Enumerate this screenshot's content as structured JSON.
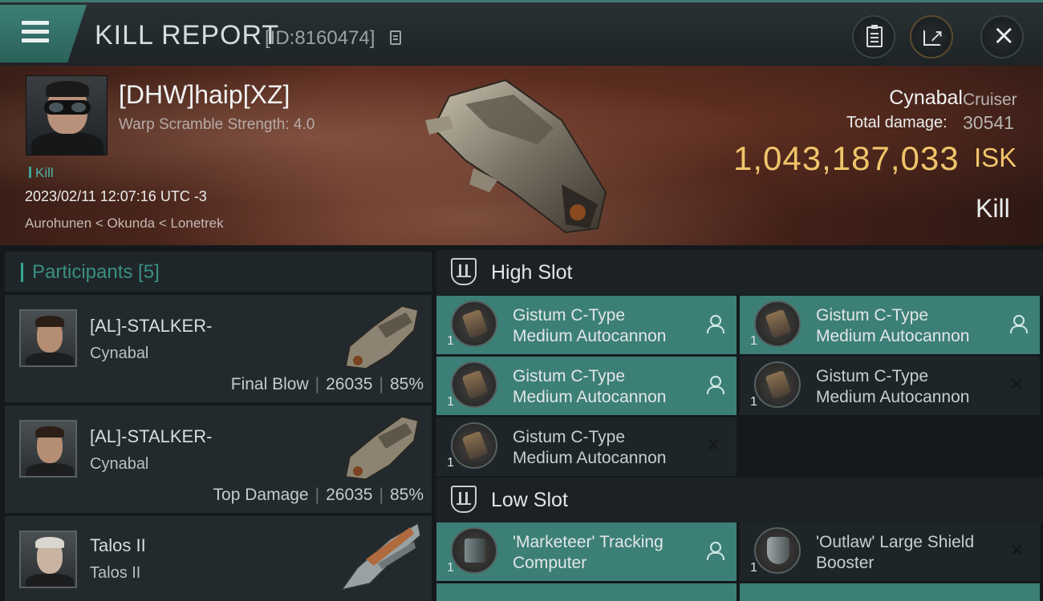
{
  "header": {
    "title": "KILL REPORT",
    "report_id": "[ID:8160474]"
  },
  "victim": {
    "name": "[DHW]haip[XZ]",
    "warp_scramble": "Warp Scramble Strength: 4.0",
    "tag": "Kill",
    "time": "2023/02/11 12:07:16 UTC -3",
    "location": "Aurohunen < Okunda < Lonetrek"
  },
  "ship": {
    "name": "Cynabal",
    "class": "Cruiser",
    "total_damage_label": "Total damage:",
    "total_damage": "30541",
    "isk_value": "1,043,187,033",
    "isk_unit": "ISK",
    "result": "Kill"
  },
  "participants": {
    "title": "Participants [5]",
    "items": [
      {
        "name": "[AL]-STALKER-",
        "ship": "Cynabal",
        "role": "Final Blow",
        "damage": "26035",
        "percent": "85%"
      },
      {
        "name": "[AL]-STALKER-",
        "ship": "Cynabal",
        "role": "Top Damage",
        "damage": "26035",
        "percent": "85%"
      },
      {
        "name": "Talos II",
        "ship": "Talos II",
        "role": "",
        "damage": "",
        "percent": ""
      }
    ]
  },
  "high_slot": {
    "label": "High Slot",
    "modules": [
      {
        "qty": "1",
        "name_line1": "Gistum C-Type",
        "name_line2": "Medium Autocannon",
        "status": "dropped"
      },
      {
        "qty": "1",
        "name_line1": "Gistum C-Type",
        "name_line2": "Medium Autocannon",
        "status": "dropped"
      },
      {
        "qty": "1",
        "name_line1": "Gistum C-Type",
        "name_line2": "Medium Autocannon",
        "status": "dropped"
      },
      {
        "qty": "1",
        "name_line1": "Gistum C-Type",
        "name_line2": "Medium Autocannon",
        "status": "destroyed"
      },
      {
        "qty": "1",
        "name_line1": "Gistum C-Type",
        "name_line2": "Medium Autocannon",
        "status": "destroyed"
      }
    ]
  },
  "low_slot": {
    "label": "Low Slot",
    "modules": [
      {
        "qty": "1",
        "name_line1": "'Marketeer' Tracking",
        "name_line2": "Computer",
        "status": "dropped"
      },
      {
        "qty": "1",
        "name_line1": "'Outlaw' Large Shield",
        "name_line2": "Booster",
        "status": "destroyed"
      }
    ]
  },
  "colors": {
    "accent_teal": "#3c7f77",
    "isk_gold": "#f0c56b",
    "badge_red": "#c3262b"
  },
  "icons": [
    "menu-icon",
    "copy-icon",
    "clipboard-icon",
    "share-icon",
    "close-icon",
    "slot-icon",
    "person-icon",
    "x-icon"
  ]
}
